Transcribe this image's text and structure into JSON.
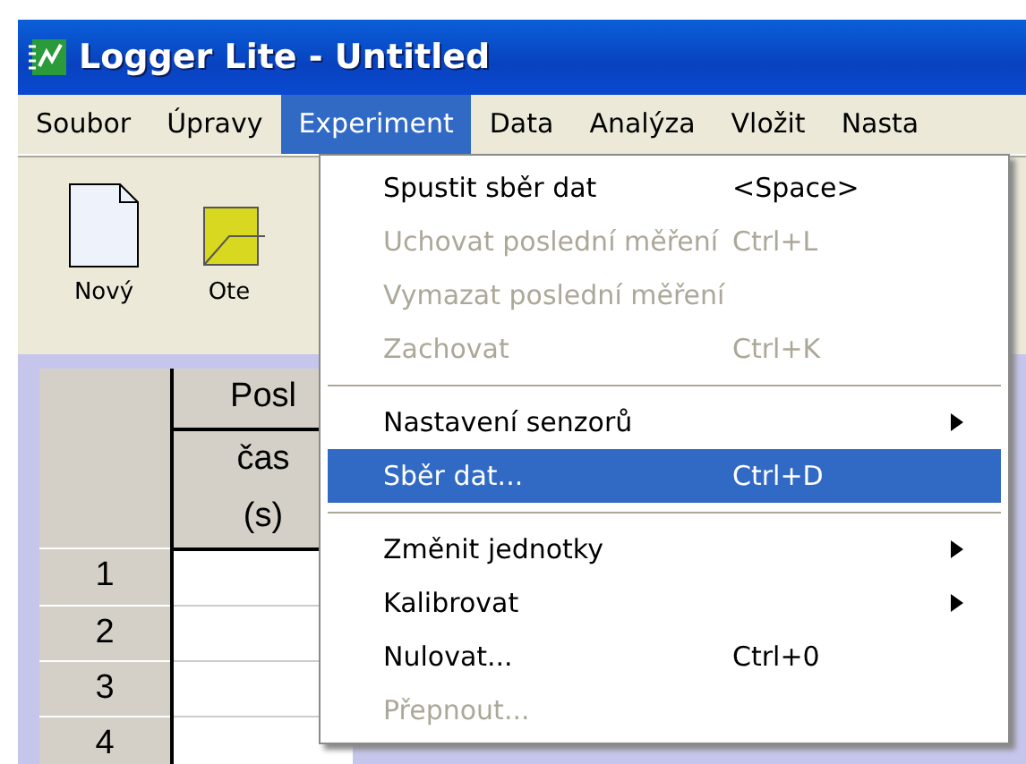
{
  "window": {
    "title": "Logger Lite - Untitled"
  },
  "menu_bar": [
    {
      "label": "Soubor",
      "selected": false
    },
    {
      "label": "Úpravy",
      "selected": false
    },
    {
      "label": "Experiment",
      "selected": true
    },
    {
      "label": "Data",
      "selected": false
    },
    {
      "label": "Analýza",
      "selected": false
    },
    {
      "label": "Vložit",
      "selected": false
    },
    {
      "label": "Nasta",
      "selected": false
    }
  ],
  "toolbar": [
    {
      "label": "Nový",
      "kind": "new"
    },
    {
      "label": "Ote",
      "kind": "open"
    }
  ],
  "table": {
    "column_header": [
      "Posl",
      "čas",
      "(s)"
    ],
    "rows": [
      "1",
      "2",
      "3",
      "4"
    ]
  },
  "menu": [
    {
      "kind": "item",
      "label": "Spustit sběr dat",
      "shortcut": "<Space>",
      "disabled": false,
      "selected": false,
      "submenu": false
    },
    {
      "kind": "item",
      "label": "Uchovat poslední měření",
      "shortcut": "Ctrl+L",
      "disabled": true,
      "selected": false,
      "submenu": false
    },
    {
      "kind": "item",
      "label": "Vymazat poslední měření",
      "disabled": true,
      "selected": false,
      "submenu": false
    },
    {
      "kind": "item",
      "label": "Zachovat",
      "shortcut": "Ctrl+K",
      "disabled": true,
      "selected": false,
      "submenu": false
    },
    {
      "kind": "separator"
    },
    {
      "kind": "item",
      "label": "Nastavení senzorů",
      "disabled": false,
      "selected": false,
      "submenu": true
    },
    {
      "kind": "item",
      "label": "Sběr dat...",
      "shortcut": "Ctrl+D",
      "disabled": false,
      "selected": true,
      "submenu": false
    },
    {
      "kind": "separator"
    },
    {
      "kind": "item",
      "label": "Změnit jednotky",
      "disabled": false,
      "selected": false,
      "submenu": true
    },
    {
      "kind": "item",
      "label": "Kalibrovat",
      "disabled": false,
      "selected": false,
      "submenu": true
    },
    {
      "kind": "item",
      "label": "Nulovat...",
      "shortcut": "Ctrl+0",
      "disabled": false,
      "selected": false,
      "submenu": false
    },
    {
      "kind": "item",
      "label": "Přepnout...",
      "disabled": true,
      "selected": false,
      "submenu": false
    }
  ]
}
